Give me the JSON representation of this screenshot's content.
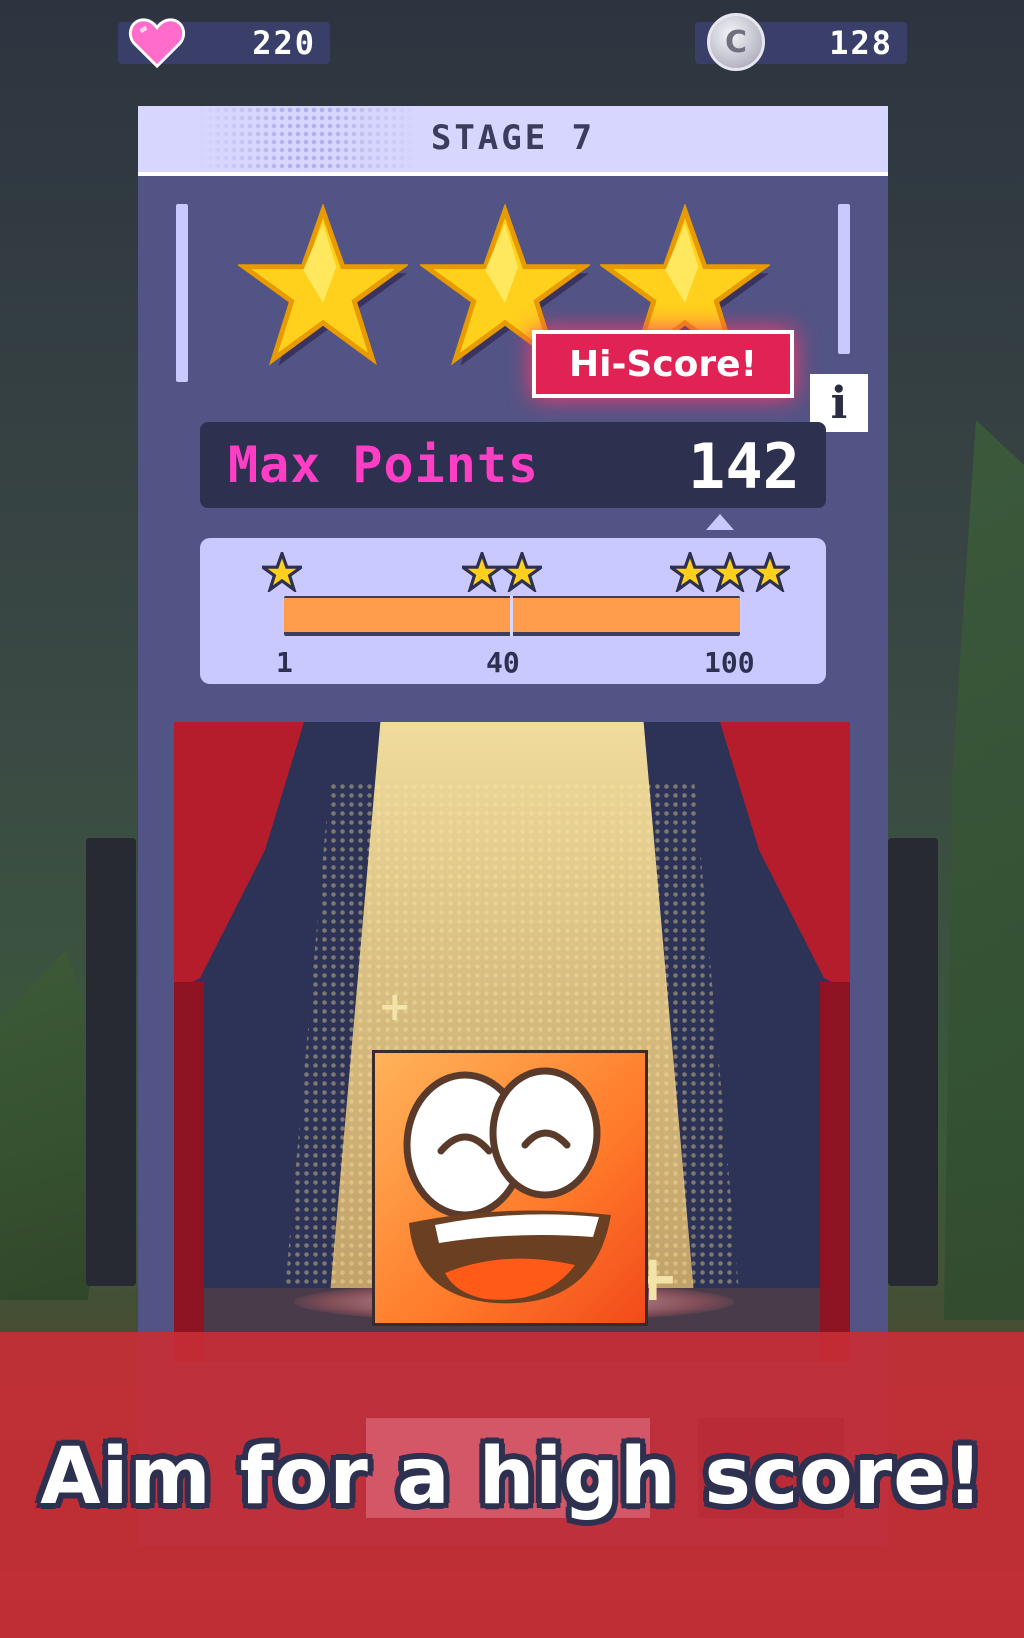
{
  "top_bar": {
    "hearts": {
      "icon": "heart-icon",
      "value": "220",
      "color": "#ff5cc6"
    },
    "coins": {
      "icon": "coin-icon",
      "symbol": "C",
      "value": "128"
    }
  },
  "card": {
    "stage_title": "STAGE 7",
    "stars_earned": 3,
    "hiscore_badge": "Hi-Score!",
    "info_label": "i",
    "max_points": {
      "label": "Max Points",
      "value": "142"
    },
    "progress": {
      "thresholds": [
        {
          "stars": 1,
          "label": "1"
        },
        {
          "stars": 2,
          "label": "40"
        },
        {
          "stars": 3,
          "label": "100"
        }
      ],
      "fill_fraction": 1.0
    },
    "character": "smiling-orange-block"
  },
  "banner": {
    "text": "Aim for a high score!"
  },
  "colors": {
    "card_bg": "#525485",
    "accent_pink": "#ff3ec5",
    "badge_red": "#e02255",
    "progress_fill": "#ff9d4d",
    "banner_red": "#c82e36"
  }
}
